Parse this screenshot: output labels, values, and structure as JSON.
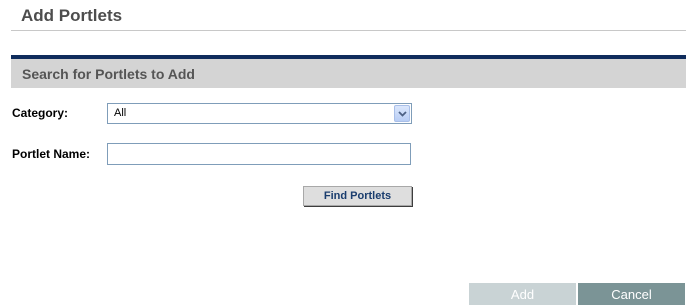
{
  "header": {
    "title": "Add Portlets"
  },
  "search_section": {
    "title": "Search for Portlets to Add",
    "category": {
      "label": "Category:",
      "selected": "All"
    },
    "portlet_name": {
      "label": "Portlet Name:",
      "value": ""
    },
    "find_button_label": "Find Portlets"
  },
  "footer": {
    "add_label": "Add",
    "add_enabled": false,
    "cancel_label": "Cancel"
  },
  "colors": {
    "section_border": "#0f2c5c",
    "section_bg": "#d4d4d4",
    "add_disabled_bg": "#c9d3d5",
    "cancel_bg": "#7b9496"
  },
  "icons": {
    "select_arrow": "chevron-down-icon"
  }
}
